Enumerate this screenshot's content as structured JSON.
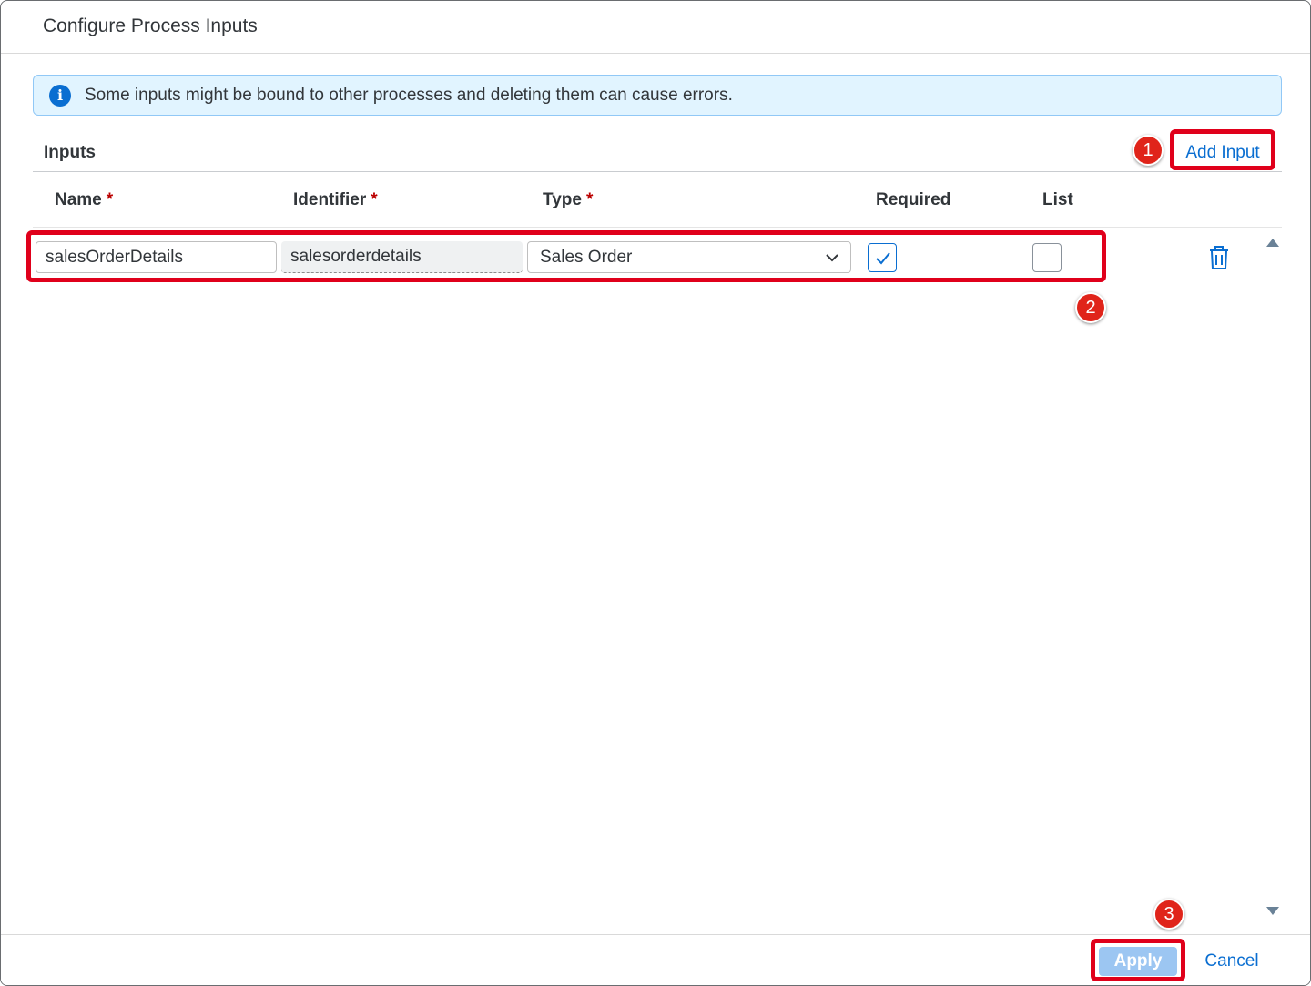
{
  "dialog": {
    "title": "Configure Process Inputs"
  },
  "info": {
    "icon": "info-icon",
    "message": "Some inputs might be bound to other processes and deleting them can cause errors."
  },
  "inputs": {
    "section_title": "Inputs",
    "add_button_label": "Add Input",
    "columns": [
      {
        "label": "Name",
        "required": true
      },
      {
        "label": "Identifier",
        "required": true
      },
      {
        "label": "Type",
        "required": true
      },
      {
        "label": "Required",
        "required": false
      },
      {
        "label": "List",
        "required": false
      }
    ],
    "required_marker": "*",
    "rows": [
      {
        "name": "salesOrderDetails",
        "identifier": "salesorderdetails",
        "type": "Sales Order",
        "required": true,
        "list": false
      }
    ]
  },
  "footer": {
    "apply_label": "Apply",
    "cancel_label": "Cancel"
  },
  "annotations": {
    "badges": [
      "1",
      "2",
      "3"
    ],
    "highlight_color": "#e0001b"
  },
  "colors": {
    "accent": "#0a6ed1",
    "info_bg": "#e1f4ff",
    "required_star": "#bb0000",
    "apply_disabled": "#9cc6f2"
  }
}
